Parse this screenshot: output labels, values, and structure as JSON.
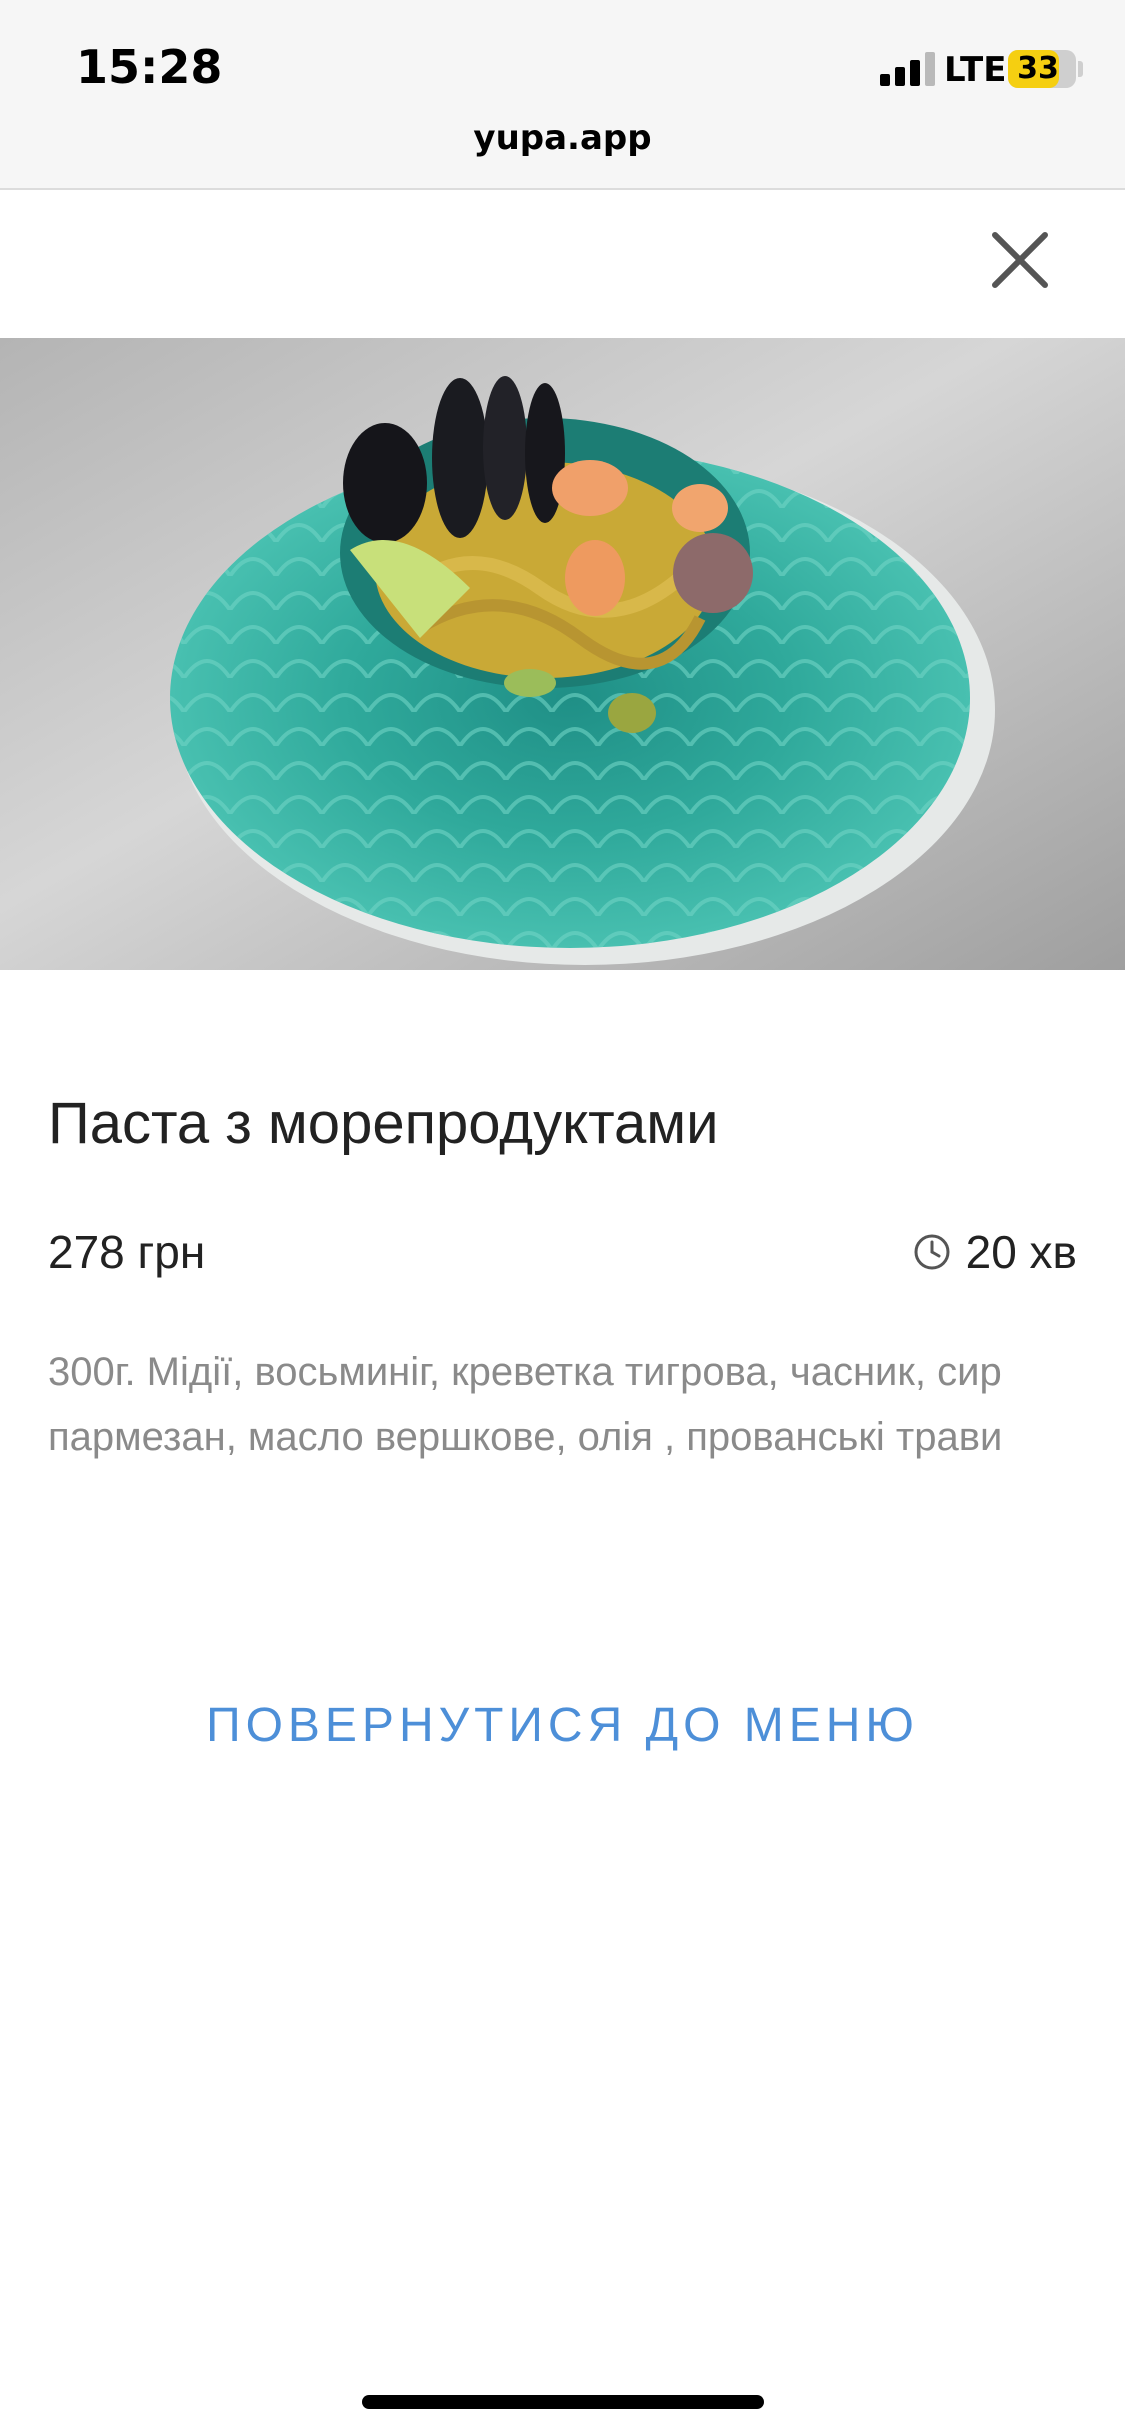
{
  "status_bar": {
    "time": "15:28",
    "network": "LTE",
    "battery_level": "33",
    "battery_fraction": 0.75,
    "battery_color": "#f5cf11",
    "signal_bars_active": 3,
    "signal_bars_total": 4
  },
  "browser": {
    "url": "yupa.app"
  },
  "dish": {
    "image_icon": "dish-photo",
    "title": "Паста з морепродуктами",
    "price": "278 грн",
    "cook_time": "20 хв",
    "description": "300г. Мідії, восьминіг, креветка тигрова, часник, сир пармезан, масло вершкове, олія , прованські трави"
  },
  "actions": {
    "back_to_menu": "ПОВЕРНУТИСЯ ДО МЕНЮ",
    "close_icon": "close-icon"
  },
  "colors": {
    "link": "#4d8fd8",
    "description_text": "#8a8a8a",
    "plate": "#2fa99b"
  }
}
